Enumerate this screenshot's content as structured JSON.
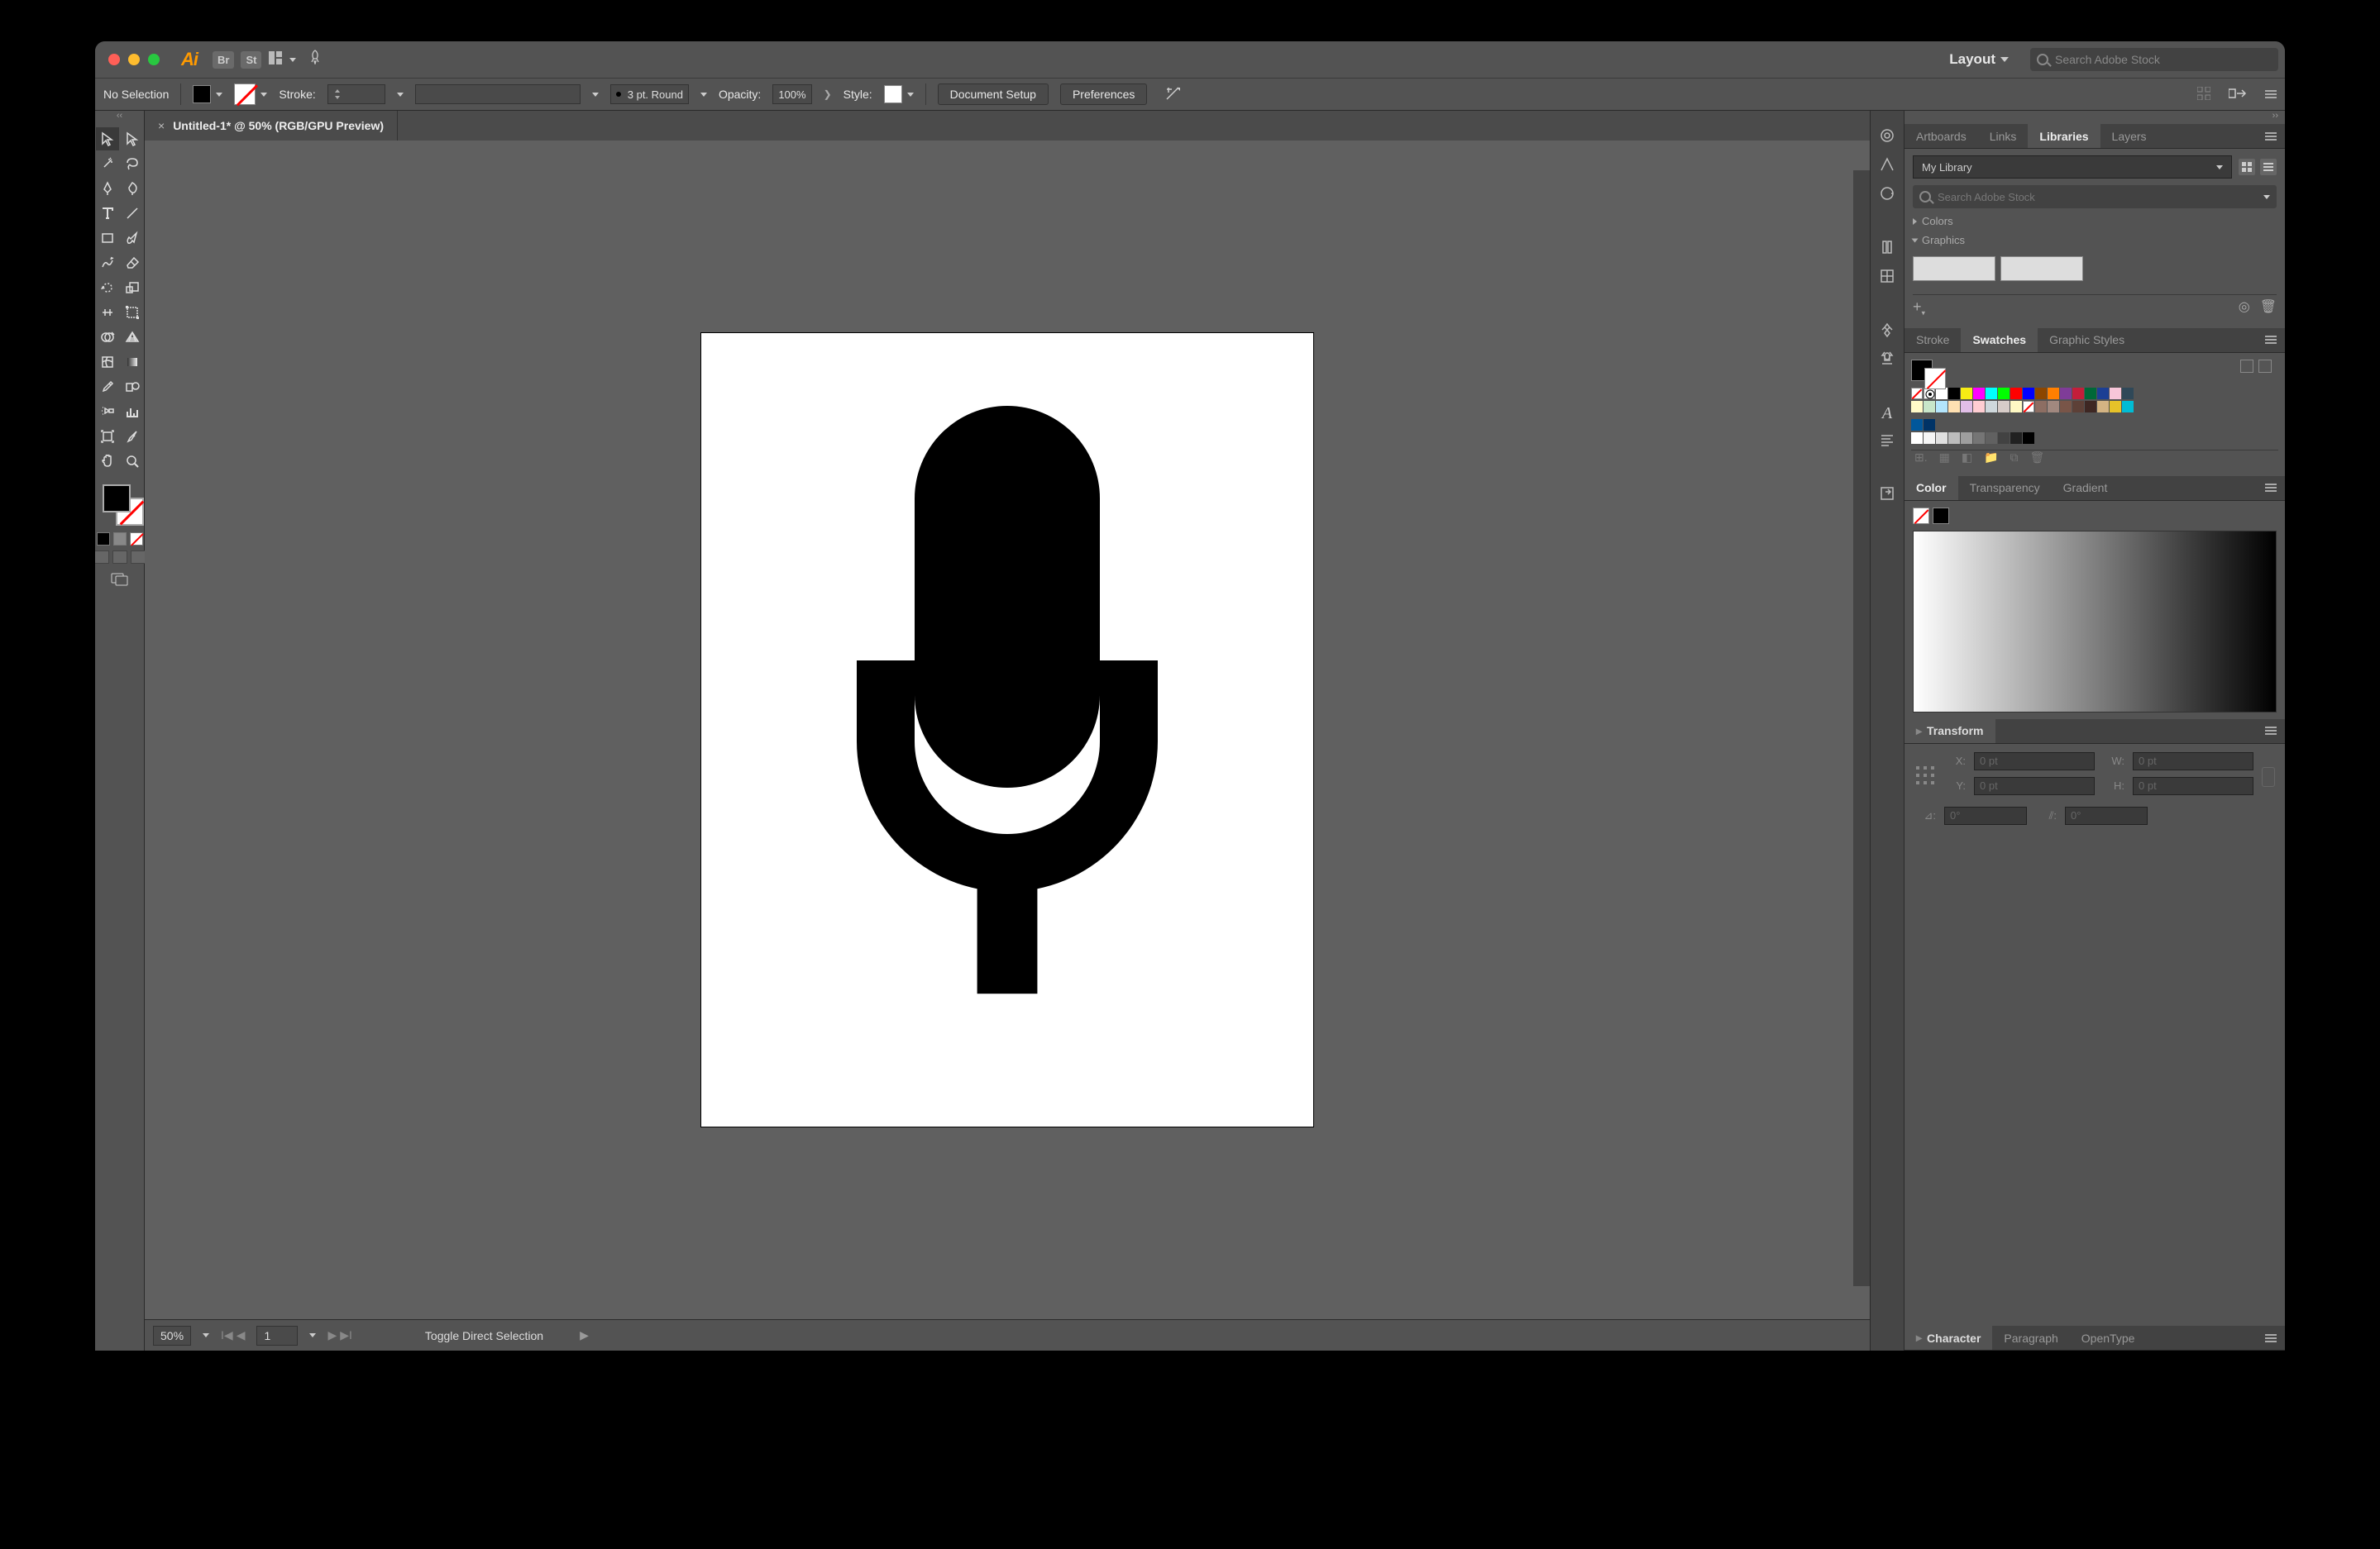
{
  "topbar": {
    "workspace": "Layout",
    "stockSearchPlaceholder": "Search Adobe Stock"
  },
  "controlbar": {
    "selection": "No Selection",
    "strokeLabel": "Stroke:",
    "strokeWidth": "",
    "brushLabel": "3 pt. Round",
    "opacityLabel": "Opacity:",
    "opacity": "100%",
    "styleLabel": "Style:",
    "docSetup": "Document Setup",
    "preferences": "Preferences"
  },
  "document": {
    "tabTitle": "Untitled-1* @ 50% (RGB/GPU Preview)"
  },
  "statusbar": {
    "zoom": "50%",
    "artboard": "1",
    "hint": "Toggle Direct Selection"
  },
  "panels": {
    "topTabs": [
      "Artboards",
      "Links",
      "Libraries",
      "Layers"
    ],
    "libraries": {
      "dropdown": "My Library",
      "searchPlaceholder": "Search Adobe Stock",
      "sections": {
        "colors": "Colors",
        "graphics": "Graphics"
      }
    },
    "midTabs": [
      "Stroke",
      "Swatches",
      "Graphic Styles"
    ],
    "colorTabs": [
      "Color",
      "Transparency",
      "Gradient"
    ],
    "transform": {
      "title": "Transform",
      "xLabel": "X:",
      "yLabel": "Y:",
      "wLabel": "W:",
      "hLabel": "H:",
      "x": "0 pt",
      "y": "0 pt",
      "w": "0 pt",
      "h": "0 pt",
      "angle": "0°",
      "shear": "0°"
    },
    "bottomTabs": [
      "Character",
      "Paragraph",
      "OpenType"
    ]
  },
  "swatchRows": [
    [
      "none",
      "reg",
      "#ffffff",
      "#000000",
      "#f6eb14",
      "#ff00ff",
      "#00ffff",
      "#00ff00",
      "#ff0000",
      "#0000ff",
      "#8c4600",
      "#ff7f00",
      "#7f3c98",
      "#c41e3a",
      "#006838",
      "#1c3f94",
      "#f7c6d9",
      "#2f4858"
    ],
    [
      "#fffac8",
      "#c8e6c9",
      "#b3e5fc",
      "#ffe0b2",
      "#e1bee7",
      "#ffcdd2",
      "#cfd8dc",
      "#d7ccc8",
      "#fff9c4",
      "none",
      "#8d6e63",
      "#a1887f",
      "#795548",
      "#5d4037",
      "#3e2723",
      "#d4b483",
      "#e6c229",
      "#00bcd4"
    ],
    [
      "#01579b",
      "#003366"
    ],
    [
      "#ffffff",
      "#f5f5f5",
      "#e0e0e0",
      "#bdbdbd",
      "#9e9e9e",
      "#757575",
      "#616161",
      "#424242",
      "#212121",
      "#000000"
    ]
  ]
}
